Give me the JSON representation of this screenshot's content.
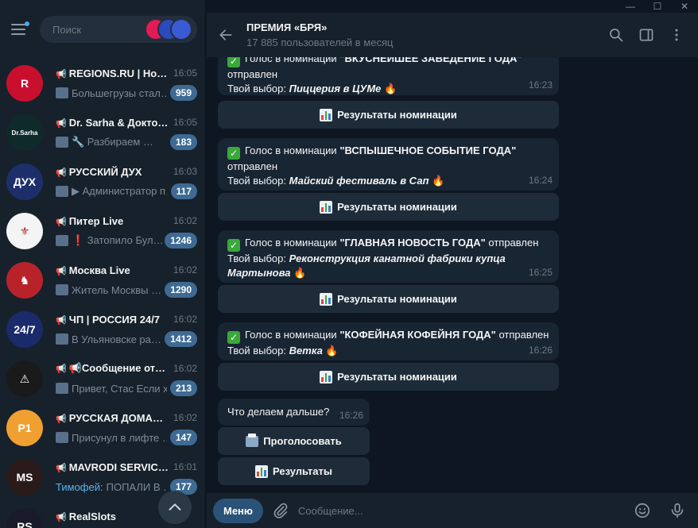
{
  "search": {
    "placeholder": "Поиск"
  },
  "chats": [
    {
      "name": "REGIONS.RU | Но…",
      "time": "16:05",
      "preview": "Большегрузы стал…",
      "badge": "959",
      "avatar_text": "R",
      "avatar_color": "#c8102e"
    },
    {
      "name": "Dr. Sarha & Докто…",
      "time": "16:05",
      "preview": "🔧 Разбираем …",
      "badge": "183",
      "avatar_text": "Dr.Sarha",
      "avatar_color": "#0f2a2a"
    },
    {
      "name": "РУССКИЙ ДУХ",
      "time": "16:03",
      "preview": "▶ Администратор п…",
      "badge": "117",
      "avatar_text": "ДУХ",
      "avatar_color": "#1d2f6b"
    },
    {
      "name": "Питер Live",
      "time": "16:02",
      "preview": "❗ Затопило Бул…",
      "badge": "1246",
      "avatar_text": "⚜",
      "avatar_color": "#f4f4f4"
    },
    {
      "name": "Москва Live",
      "time": "16:02",
      "preview": "Житель Москвы …",
      "badge": "1290",
      "avatar_text": "♞",
      "avatar_color": "#b8232a"
    },
    {
      "name": "ЧП | РОССИЯ 24/7",
      "time": "16:02",
      "preview": "В Ульяновске ра…",
      "badge": "1412",
      "avatar_text": "24/7",
      "avatar_color": "#1a2a6b"
    },
    {
      "name": "📢Сообщение от…",
      "time": "16:02",
      "preview": "Привет, Стас  Если хо…",
      "badge": "213",
      "avatar_text": "⚠",
      "avatar_color": "#1a1a1a"
    },
    {
      "name": "РУССКАЯ ДОМАШ…",
      "time": "16:02",
      "preview": "Присунул в лифте …",
      "badge": "147",
      "avatar_text": "P1",
      "avatar_color": "#f0a030"
    },
    {
      "name": "MAVRODI SERVIC…",
      "time": "16:01",
      "sender": "Тимофей:",
      "preview": "ПОПАЛИ В …",
      "badge": "177",
      "avatar_text": "MS",
      "avatar_color": "#2a1a1a"
    },
    {
      "name": "RealSlots",
      "time": "",
      "preview": "",
      "badge": "",
      "avatar_text": "RS",
      "avatar_color": "#1a1a2a"
    }
  ],
  "header": {
    "title": "ПРЕМИЯ «БРЯ»",
    "subtitle": "17 885 пользователей в месяц"
  },
  "messages": [
    {
      "prefix": "Голос в номинации",
      "nomination": "\"ВКУСНЕЙШЕЕ ЗАВЕДЕНИЕ ГОДА\"",
      "suffix": "отправлен",
      "choice_label": "Твой выбор:",
      "choice": "Пиццерия в ЦУМе",
      "time": "16:23",
      "button": "Результаты номинации"
    },
    {
      "prefix": "Голос в номинации",
      "nomination": "\"ВСПЫШЕЧНОЕ СОБЫТИЕ ГОДА\"",
      "suffix": "отправлен",
      "choice_label": "Твой выбор:",
      "choice": "Майский фестиваль в Сап",
      "time": "16:24",
      "button": "Результаты номинации"
    },
    {
      "prefix": "Голос в номинации",
      "nomination": "\"ГЛАВНАЯ НОВОСТЬ ГОДА\"",
      "suffix": "отправлен",
      "choice_label": "Твой выбор:",
      "choice": "Реконструкция канатной фабрики купца Мартынова",
      "time": "16:25",
      "button": "Результаты номинации"
    },
    {
      "prefix": "Голос в номинации",
      "nomination": "\"КОФЕЙНАЯ КОФЕЙНЯ ГОДА\"",
      "suffix": "отправлен",
      "choice_label": "Твой выбор:",
      "choice": "Ветка",
      "time": "16:26",
      "button": "Результаты номинации"
    }
  ],
  "last_message": {
    "text": "Что делаем дальше?",
    "time": "16:26",
    "buttons": [
      "Проголосовать",
      "Результаты"
    ]
  },
  "composer": {
    "menu_label": "Меню",
    "placeholder": "Сообщение..."
  }
}
